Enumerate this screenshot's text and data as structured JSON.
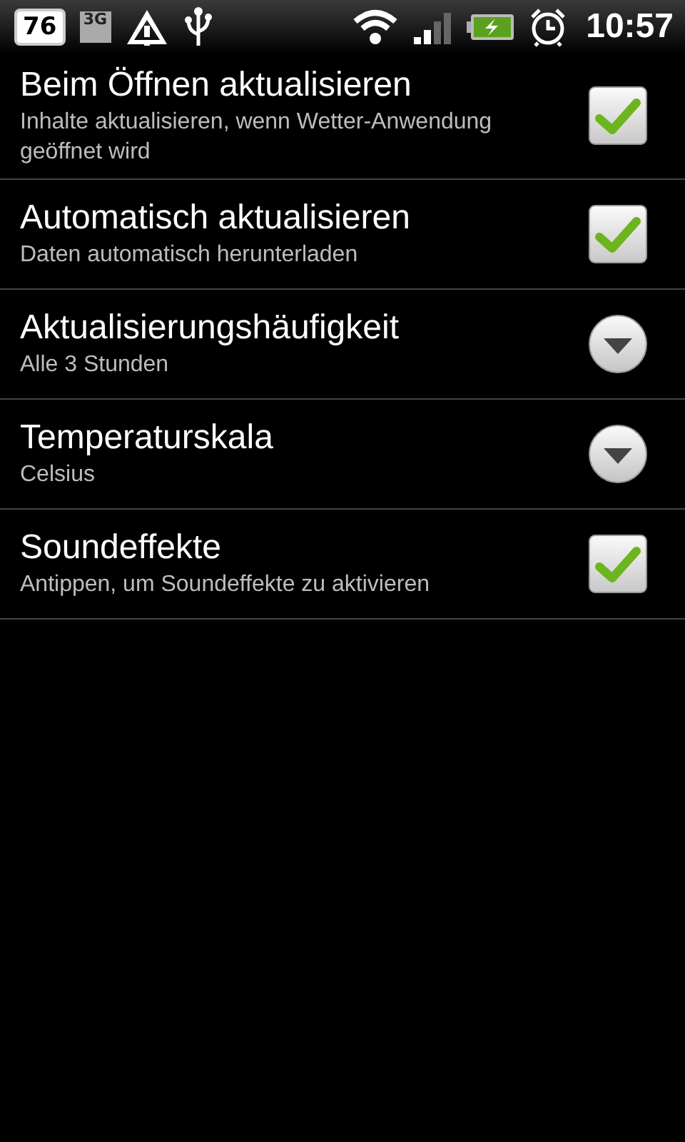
{
  "status_bar": {
    "battery_badge": "76",
    "network": "3G",
    "time": "10:57"
  },
  "settings": [
    {
      "title": "Beim Öffnen aktualisieren",
      "summary": "Inhalte aktualisieren, wenn Wetter-Anwendung geöffnet wird",
      "kind": "checkbox",
      "checked": true
    },
    {
      "title": "Automatisch aktualisieren",
      "summary": "Daten automatisch herunterladen",
      "kind": "checkbox",
      "checked": true
    },
    {
      "title": "Aktualisierungshäufigkeit",
      "summary": "Alle 3 Stunden",
      "kind": "dropdown"
    },
    {
      "title": "Temperaturskala",
      "summary": "Celsius",
      "kind": "dropdown"
    },
    {
      "title": "Soundeffekte",
      "summary": "Antippen, um Soundeffekte zu aktivieren",
      "kind": "checkbox",
      "checked": true
    }
  ]
}
